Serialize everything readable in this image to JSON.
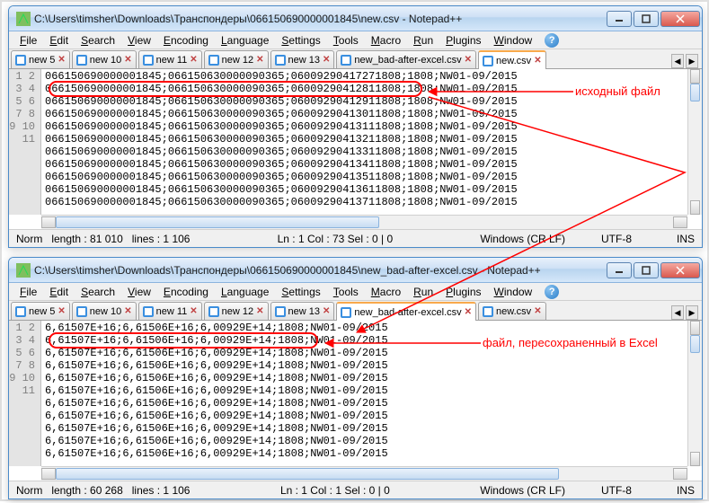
{
  "windowA": {
    "title": "C:\\Users\\timsher\\Downloads\\Транспондеры\\066150690000001845\\new.csv - Notepad++",
    "menu": [
      "File",
      "Edit",
      "Search",
      "View",
      "Encoding",
      "Language",
      "Settings",
      "Tools",
      "Macro",
      "Run",
      "Plugins",
      "Window",
      "?"
    ],
    "tabs": [
      {
        "label": "new 5",
        "close": true,
        "active": false
      },
      {
        "label": "new 10",
        "close": true,
        "active": false
      },
      {
        "label": "new 11",
        "close": true,
        "active": false
      },
      {
        "label": "new 12",
        "close": true,
        "active": false
      },
      {
        "label": "new 13",
        "close": true,
        "active": false
      },
      {
        "label": "new_bad-after-excel.csv",
        "close": true,
        "active": false
      },
      {
        "label": "new.csv",
        "close": true,
        "active": true
      }
    ],
    "gutter_start": 1,
    "lines": [
      "066150690000001845;066150630000090365;06009290417271808;1808;NW01-09/2015",
      "066150690000001845;066150630000090365;06009290412811808;1808;NW01-09/2015",
      "066150690000001845;066150630000090365;06009290412911808;1808;NW01-09/2015",
      "066150690000001845;066150630000090365;06009290413011808;1808;NW01-09/2015",
      "066150690000001845;066150630000090365;06009290413111808;1808;NW01-09/2015",
      "066150690000001845;066150630000090365;06009290413211808;1808;NW01-09/2015",
      "066150690000001845;066150630000090365;06009290413311808;1808;NW01-09/2015",
      "066150690000001845;066150630000090365;06009290413411808;1808;NW01-09/2015",
      "066150690000001845;066150630000090365;06009290413511808;1808;NW01-09/2015",
      "066150690000001845;066150630000090365;06009290413611808;1808;NW01-09/2015",
      "066150690000001845;066150630000090365;06009290413711808;1808;NW01-09/2015"
    ],
    "status": {
      "norm": "Norm",
      "length": "length : 81 010",
      "lines": "lines : 1 106",
      "pos": "Ln : 1    Col : 73    Sel : 0 | 0",
      "eol": "Windows (CR LF)",
      "enc": "UTF-8",
      "ins": "INS"
    }
  },
  "windowB": {
    "title": "C:\\Users\\timsher\\Downloads\\Транспондеры\\066150690000001845\\new_bad-after-excel.csv - Notepad++",
    "menu": [
      "File",
      "Edit",
      "Search",
      "View",
      "Encoding",
      "Language",
      "Settings",
      "Tools",
      "Macro",
      "Run",
      "Plugins",
      "Window",
      "?"
    ],
    "tabs": [
      {
        "label": "new 5",
        "close": true,
        "active": false
      },
      {
        "label": "new 10",
        "close": true,
        "active": false
      },
      {
        "label": "new 11",
        "close": true,
        "active": false
      },
      {
        "label": "new 12",
        "close": true,
        "active": false
      },
      {
        "label": "new 13",
        "close": true,
        "active": false
      },
      {
        "label": "new_bad-after-excel.csv",
        "close": true,
        "active": true
      },
      {
        "label": "new.csv",
        "close": true,
        "active": false
      }
    ],
    "gutter_start": 1,
    "lines": [
      "6,61507E+16;6,61506E+16;6,00929E+14;1808;NW01-09/2015",
      "6,61507E+16;6,61506E+16;6,00929E+14;1808;NW01-09/2015",
      "6,61507E+16;6,61506E+16;6,00929E+14;1808;NW01-09/2015",
      "6,61507E+16;6,61506E+16;6,00929E+14;1808;NW01-09/2015",
      "6,61507E+16;6,61506E+16;6,00929E+14;1808;NW01-09/2015",
      "6,61507E+16;6,61506E+16;6,00929E+14;1808;NW01-09/2015",
      "6,61507E+16;6,61506E+16;6,00929E+14;1808;NW01-09/2015",
      "6,61507E+16;6,61506E+16;6,00929E+14;1808;NW01-09/2015",
      "6,61507E+16;6,61506E+16;6,00929E+14;1808;NW01-09/2015",
      "6,61507E+16;6,61506E+16;6,00929E+14;1808;NW01-09/2015",
      "6,61507E+16;6,61506E+16;6,00929E+14;1808;NW01-09/2015"
    ],
    "status": {
      "norm": "Norm",
      "length": "length : 60 268",
      "lines": "lines : 1 106",
      "pos": "Ln : 1    Col : 1    Sel : 0 | 0",
      "eol": "Windows (CR LF)",
      "enc": "UTF-8",
      "ins": "INS"
    }
  },
  "annotations": {
    "a1": "исходный файл",
    "a2": "файл, пересохраненный в Excel"
  }
}
